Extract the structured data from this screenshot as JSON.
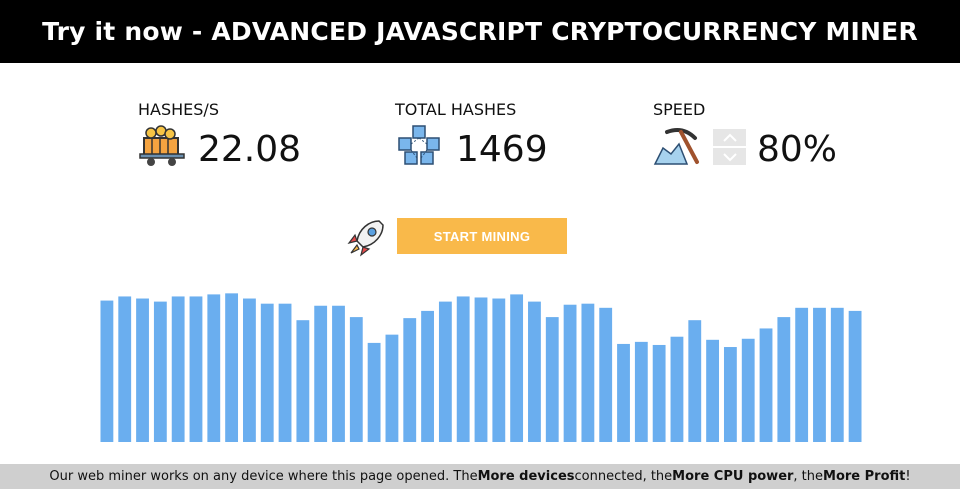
{
  "header": {
    "title": "Try it now - ADVANCED JAVASCRIPT CRYPTOCURRENCY MINER"
  },
  "stats": {
    "hashes_per_sec": {
      "label": "HASHES/S",
      "value": "22.08",
      "icon": "mining-cart-icon"
    },
    "total_hashes": {
      "label": "TOTAL HASHES",
      "value": "1469",
      "icon": "blockchain-cubes-icon"
    },
    "speed": {
      "label": "SPEED",
      "value": "80%",
      "icon": "pickaxe-icon"
    }
  },
  "actions": {
    "start_label": "START MINING",
    "rocket_icon": "rocket-icon"
  },
  "colors": {
    "bar": "#6aaeef",
    "button": "#f9b94a",
    "header_bg": "#000000",
    "footer_bg": "#cfcfcf"
  },
  "chart_data": {
    "type": "bar",
    "values": [
      137,
      141,
      139,
      136,
      141,
      141,
      143,
      144,
      139,
      134,
      134,
      118,
      132,
      132,
      121,
      96,
      104,
      120,
      127,
      136,
      141,
      140,
      139,
      143,
      136,
      121,
      133,
      134,
      130,
      95,
      97,
      94,
      102,
      118,
      99,
      92,
      100,
      110,
      121,
      130,
      130,
      130,
      127
    ],
    "ylim": [
      0,
      155
    ],
    "grid": false
  },
  "footer": {
    "t1": "Our web miner works on any device where this page opened. The ",
    "b1": "More devices",
    "t2": " connected, the ",
    "b2": "More CPU power",
    "t3": ", the ",
    "b3": "More Profit",
    "t4": "!"
  }
}
